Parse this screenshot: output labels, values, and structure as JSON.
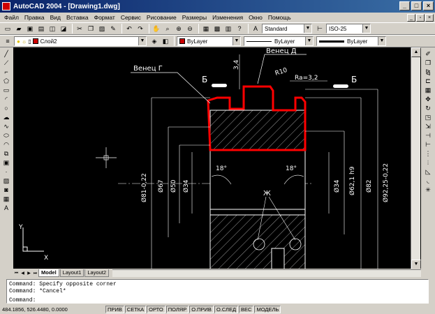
{
  "window": {
    "title": "AutoCAD 2004 - [Drawing1.dwg]"
  },
  "menu": [
    "Файл",
    "Правка",
    "Вид",
    "Вставка",
    "Формат",
    "Сервис",
    "Рисование",
    "Размеры",
    "Изменения",
    "Окно",
    "Помощь"
  ],
  "toolbar": {
    "text_style": "Standard",
    "dim_style": "ISO-25",
    "layer": "Слой2",
    "color": "ByLayer",
    "linetype": "ByLayer",
    "lineweight": "ByLayer",
    "color_swatch": "#cc0000"
  },
  "drawing": {
    "labels": {
      "venec_g": "Венец Г",
      "venec_d": "Венец Д",
      "section_left": "Б",
      "section_right": "Б",
      "dim_34_top": "3,4",
      "radius": "R10",
      "roughness": "Ra=3,2",
      "angle_left": "18°",
      "angle_right": "18°",
      "mark_zh": "Ж",
      "d81": "Ø81-0,22",
      "d67": "Ø67",
      "d50": "Ø50",
      "d34_left": "Ø34",
      "d34_right": "Ø34",
      "d62": "Ø62,1 h9",
      "d82": "Ø82",
      "d92": "Ø92,25-0,22"
    },
    "highlight_color": "#ff0000",
    "ucs": {
      "x": "X",
      "y": "Y"
    }
  },
  "tabs": [
    "Model",
    "Layout1",
    "Layout2"
  ],
  "command": {
    "lines": [
      "Command: Specify opposite corner",
      "Command: *Cancel*"
    ],
    "prompt": "Command:"
  },
  "status": {
    "coords": "484.1856, 526.4480, 0.0000",
    "toggles": [
      "ПРИВ",
      "СЕТКА",
      "ОРТО",
      "ПОЛЯР",
      "О.ПРИВ",
      "О.СЛЕД",
      "ВЕС",
      "МОДЕЛЬ"
    ]
  }
}
